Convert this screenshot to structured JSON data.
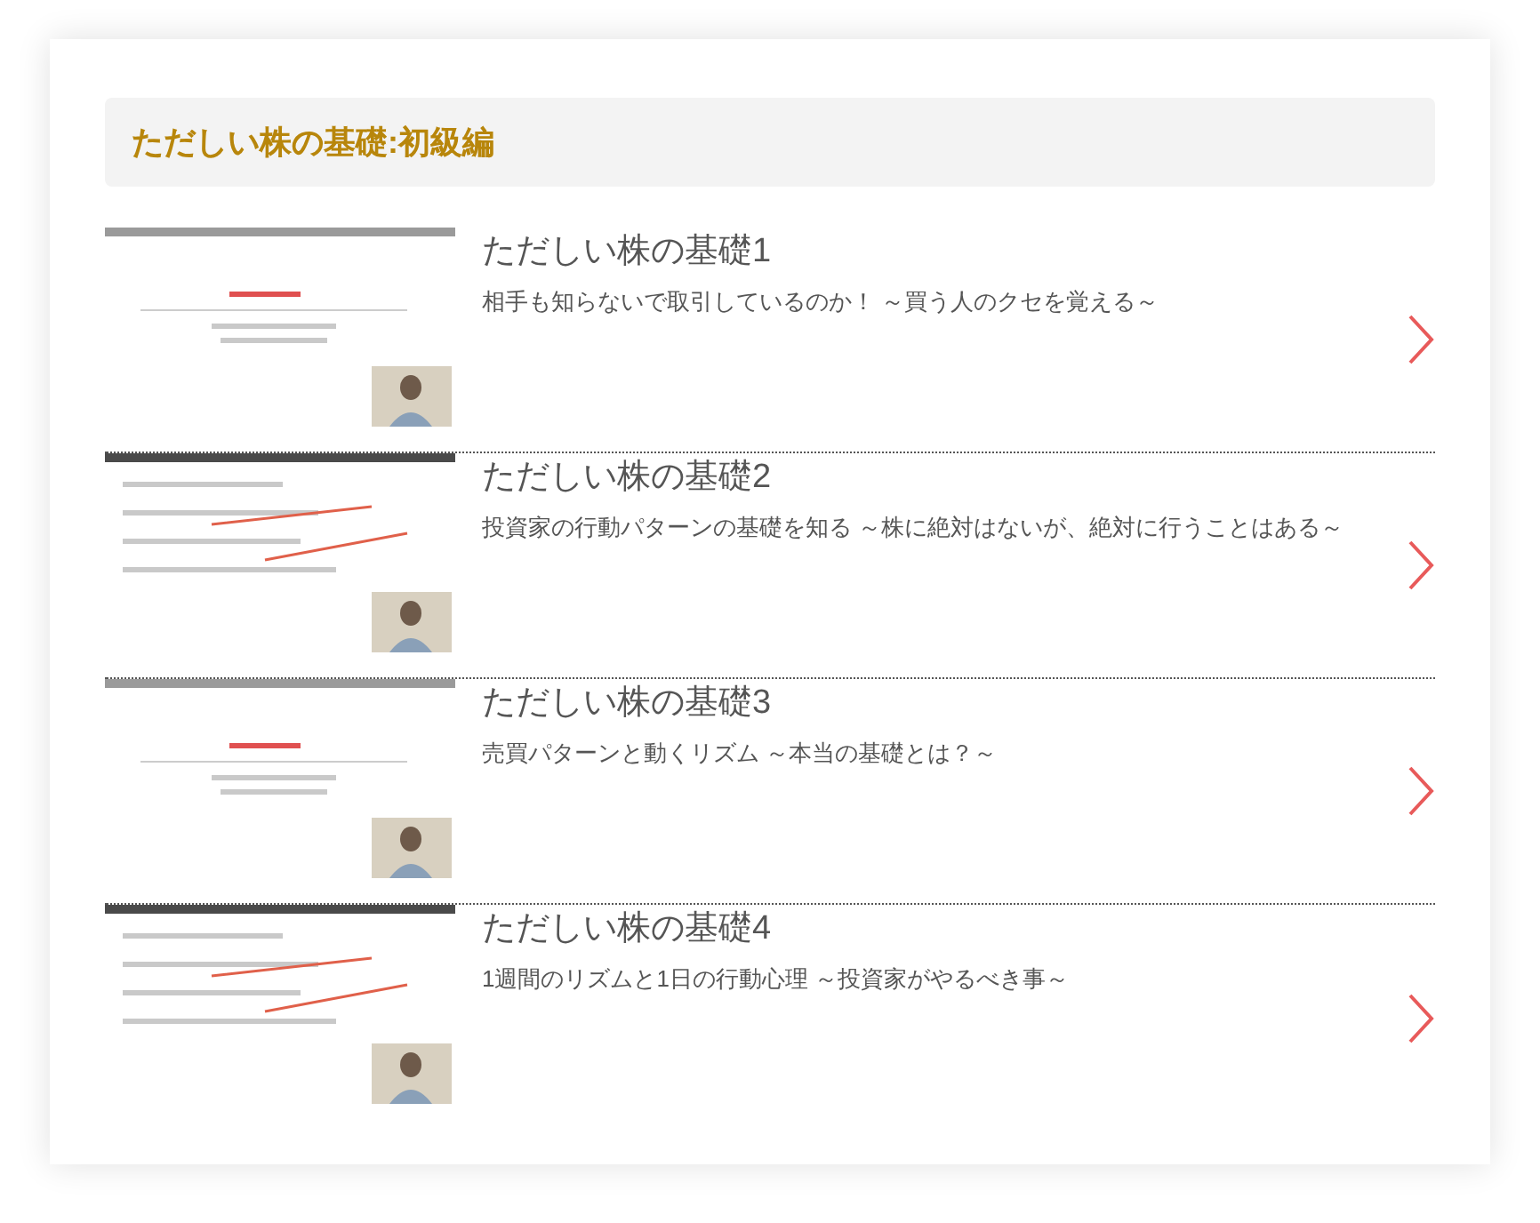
{
  "section": {
    "title": "ただしい株の基礎:初級編"
  },
  "lessons": [
    {
      "kind": "picture",
      "title": "ただしい株の基礎1",
      "subtitle": "相手も知らないで取引しているのか！ ～買う人のクセを覚える～"
    },
    {
      "kind": "picture",
      "title": "ただしい株の基礎2",
      "subtitle": "投資家の行動パターンの基礎を知る ～株に絶対はないが、絶対に行うことはある～"
    },
    {
      "kind": "picture",
      "title": "ただしい株の基礎3",
      "subtitle": "売買パターンと動くリズム ～本当の基礎とは？～"
    },
    {
      "kind": "picture",
      "title": "ただしい株の基礎4",
      "subtitle": "1週間のリズムと1日の行動心理 ～投資家がやるべき事～"
    }
  ]
}
